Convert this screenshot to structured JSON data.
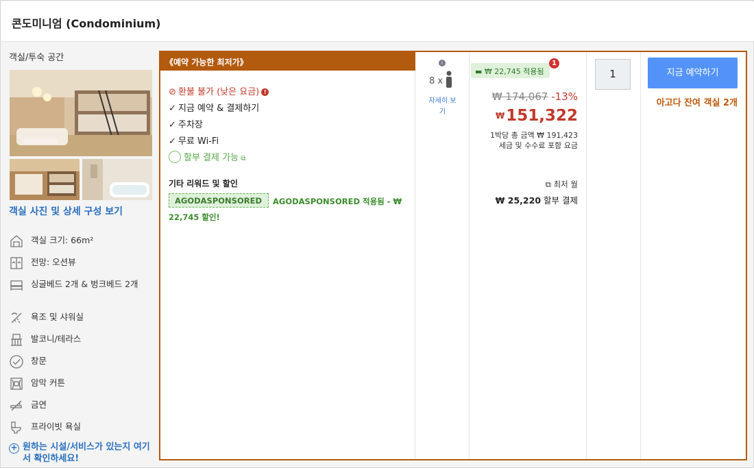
{
  "header": {
    "title": "콘도미니엄 (Condominium)"
  },
  "room": {
    "section_label": "객실/투숙 공간",
    "photo_link": "객실 사진 및 상세 구성 보기",
    "features": [
      {
        "icon": "room-size-icon",
        "label": "객실 크기: 66m²"
      },
      {
        "icon": "view-icon",
        "label": "전망: 오션뷰"
      },
      {
        "icon": "bed-icon",
        "label": "싱글베드 2개 & 벙크베드 2개"
      },
      {
        "icon": "shower-icon",
        "label": "욕조 및 샤워실"
      },
      {
        "icon": "balcony-icon",
        "label": "발코니/테라스"
      },
      {
        "icon": "window-icon",
        "label": "창문"
      },
      {
        "icon": "curtain-icon",
        "label": "암막 커튼"
      },
      {
        "icon": "no-smoking-icon",
        "label": "금연"
      },
      {
        "icon": "toilet-icon",
        "label": "프라이빗 욕실"
      }
    ],
    "ask_link": "원하는 시설/서비스가 있는지 여기서 확인하세요!"
  },
  "offer": {
    "banner": "《예약 가능한 최저가》",
    "conditions": {
      "refund": "환불 불가 (낮은 요금)",
      "pay_now": "지금 예약 & 결제하기",
      "parking": "주차장",
      "wifi": "무료 Wi-Fi",
      "installment": "할부 결제 가능"
    },
    "other_title": "기타 리워드 및 할인",
    "promo_tag": "AGODASPONSORED",
    "promo_text": "AGODASPONSORED 적용됨 - ₩ 22,745 할인!",
    "occupancy": {
      "count_text": "8 x",
      "detail_link": "자세히 보기"
    },
    "price": {
      "promo_badge": "₩ 22,745 적용됨",
      "promo_count": "1",
      "original": "₩ 174,067",
      "discount": "-13%",
      "currency": "₩",
      "final": "151,322",
      "total_line": "1박당 총 금액 ₩ 191,423",
      "tax_line": "세금 및 수수료 포함 요금",
      "installment_label": "최저 월",
      "installment_amount": "₩ 25,220",
      "installment_suffix": "할부 결제"
    },
    "quantity": "1",
    "book_button": "지금 예약하기",
    "rooms_left": "아고다 잔여 객실 2개"
  },
  "colors": {
    "accent": "#b25a0d",
    "price_red": "#c0392b",
    "book_blue": "#5392f9",
    "promo_green": "#3d8c2e"
  }
}
